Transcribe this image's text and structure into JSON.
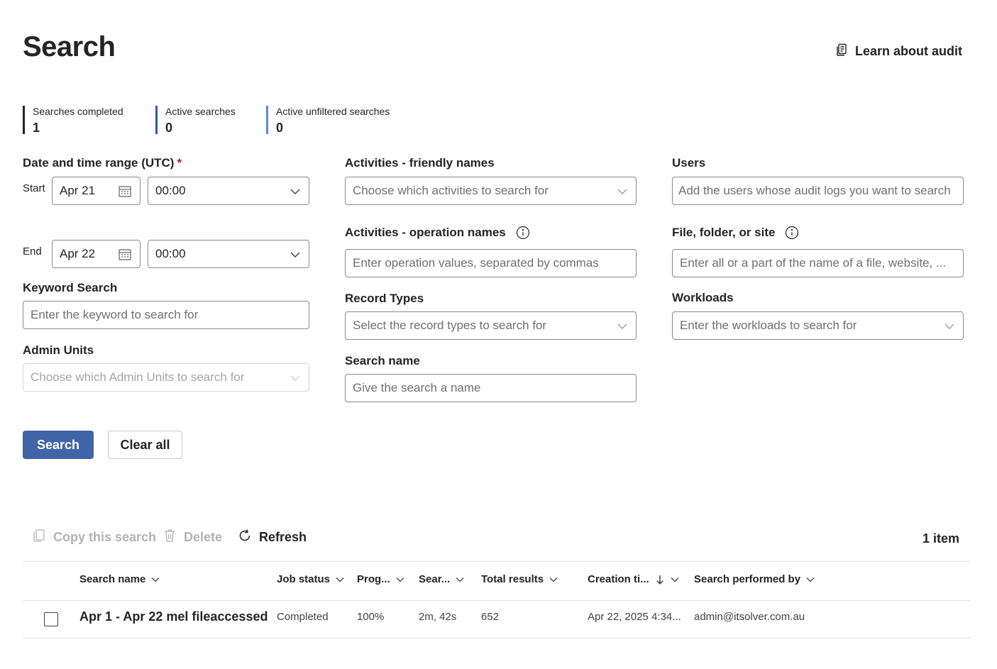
{
  "header": {
    "title": "Search",
    "learn_link": "Learn about audit"
  },
  "stats": [
    {
      "label": "Searches completed",
      "value": "1"
    },
    {
      "label": "Active searches",
      "value": "0"
    },
    {
      "label": "Active unfiltered searches",
      "value": "0"
    }
  ],
  "form": {
    "date_range": {
      "label": "Date and time range (UTC)",
      "required_mark": "*",
      "start_label": "Start",
      "start_date": "Apr 21",
      "start_time": "00:00",
      "end_label": "End",
      "end_date": "Apr 22",
      "end_time": "00:00"
    },
    "keyword": {
      "label": "Keyword Search",
      "placeholder": "Enter the keyword to search for"
    },
    "admin_units": {
      "label": "Admin Units",
      "placeholder": "Choose which Admin Units to search for"
    },
    "activities_friendly": {
      "label": "Activities - friendly names",
      "placeholder": "Choose which activities to search for"
    },
    "activities_operation": {
      "label": "Activities - operation names",
      "placeholder": "Enter operation values, separated by commas"
    },
    "record_types": {
      "label": "Record Types",
      "placeholder": "Select the record types to search for"
    },
    "search_name": {
      "label": "Search name",
      "placeholder": "Give the search a name"
    },
    "users": {
      "label": "Users",
      "placeholder": "Add the users whose audit logs you want to search"
    },
    "file_folder_site": {
      "label": "File, folder, or site",
      "placeholder": "Enter all or a part of the name of a file, website, ..."
    },
    "workloads": {
      "label": "Workloads",
      "placeholder": "Enter the workloads to search for"
    }
  },
  "actions": {
    "search": "Search",
    "clear_all": "Clear all"
  },
  "toolbar": {
    "copy": "Copy this search",
    "delete": "Delete",
    "refresh": "Refresh",
    "item_count": "1 item"
  },
  "table": {
    "columns": [
      "Search name",
      "Job status",
      "Prog...",
      "Sear...",
      "Total results",
      "Creation ti...",
      "Search performed by"
    ],
    "rows": [
      {
        "name": "Apr 1 - Apr 22 mel fileaccessed",
        "status": "Completed",
        "progress": "100%",
        "duration": "2m, 42s",
        "total": "652",
        "created": "Apr 22, 2025 4:34...",
        "by": "admin@itsolver.com.au"
      }
    ]
  },
  "colors": {
    "primary": "#3f64a8",
    "accent_blue": "#5b86e5",
    "required": "#a4262c"
  }
}
